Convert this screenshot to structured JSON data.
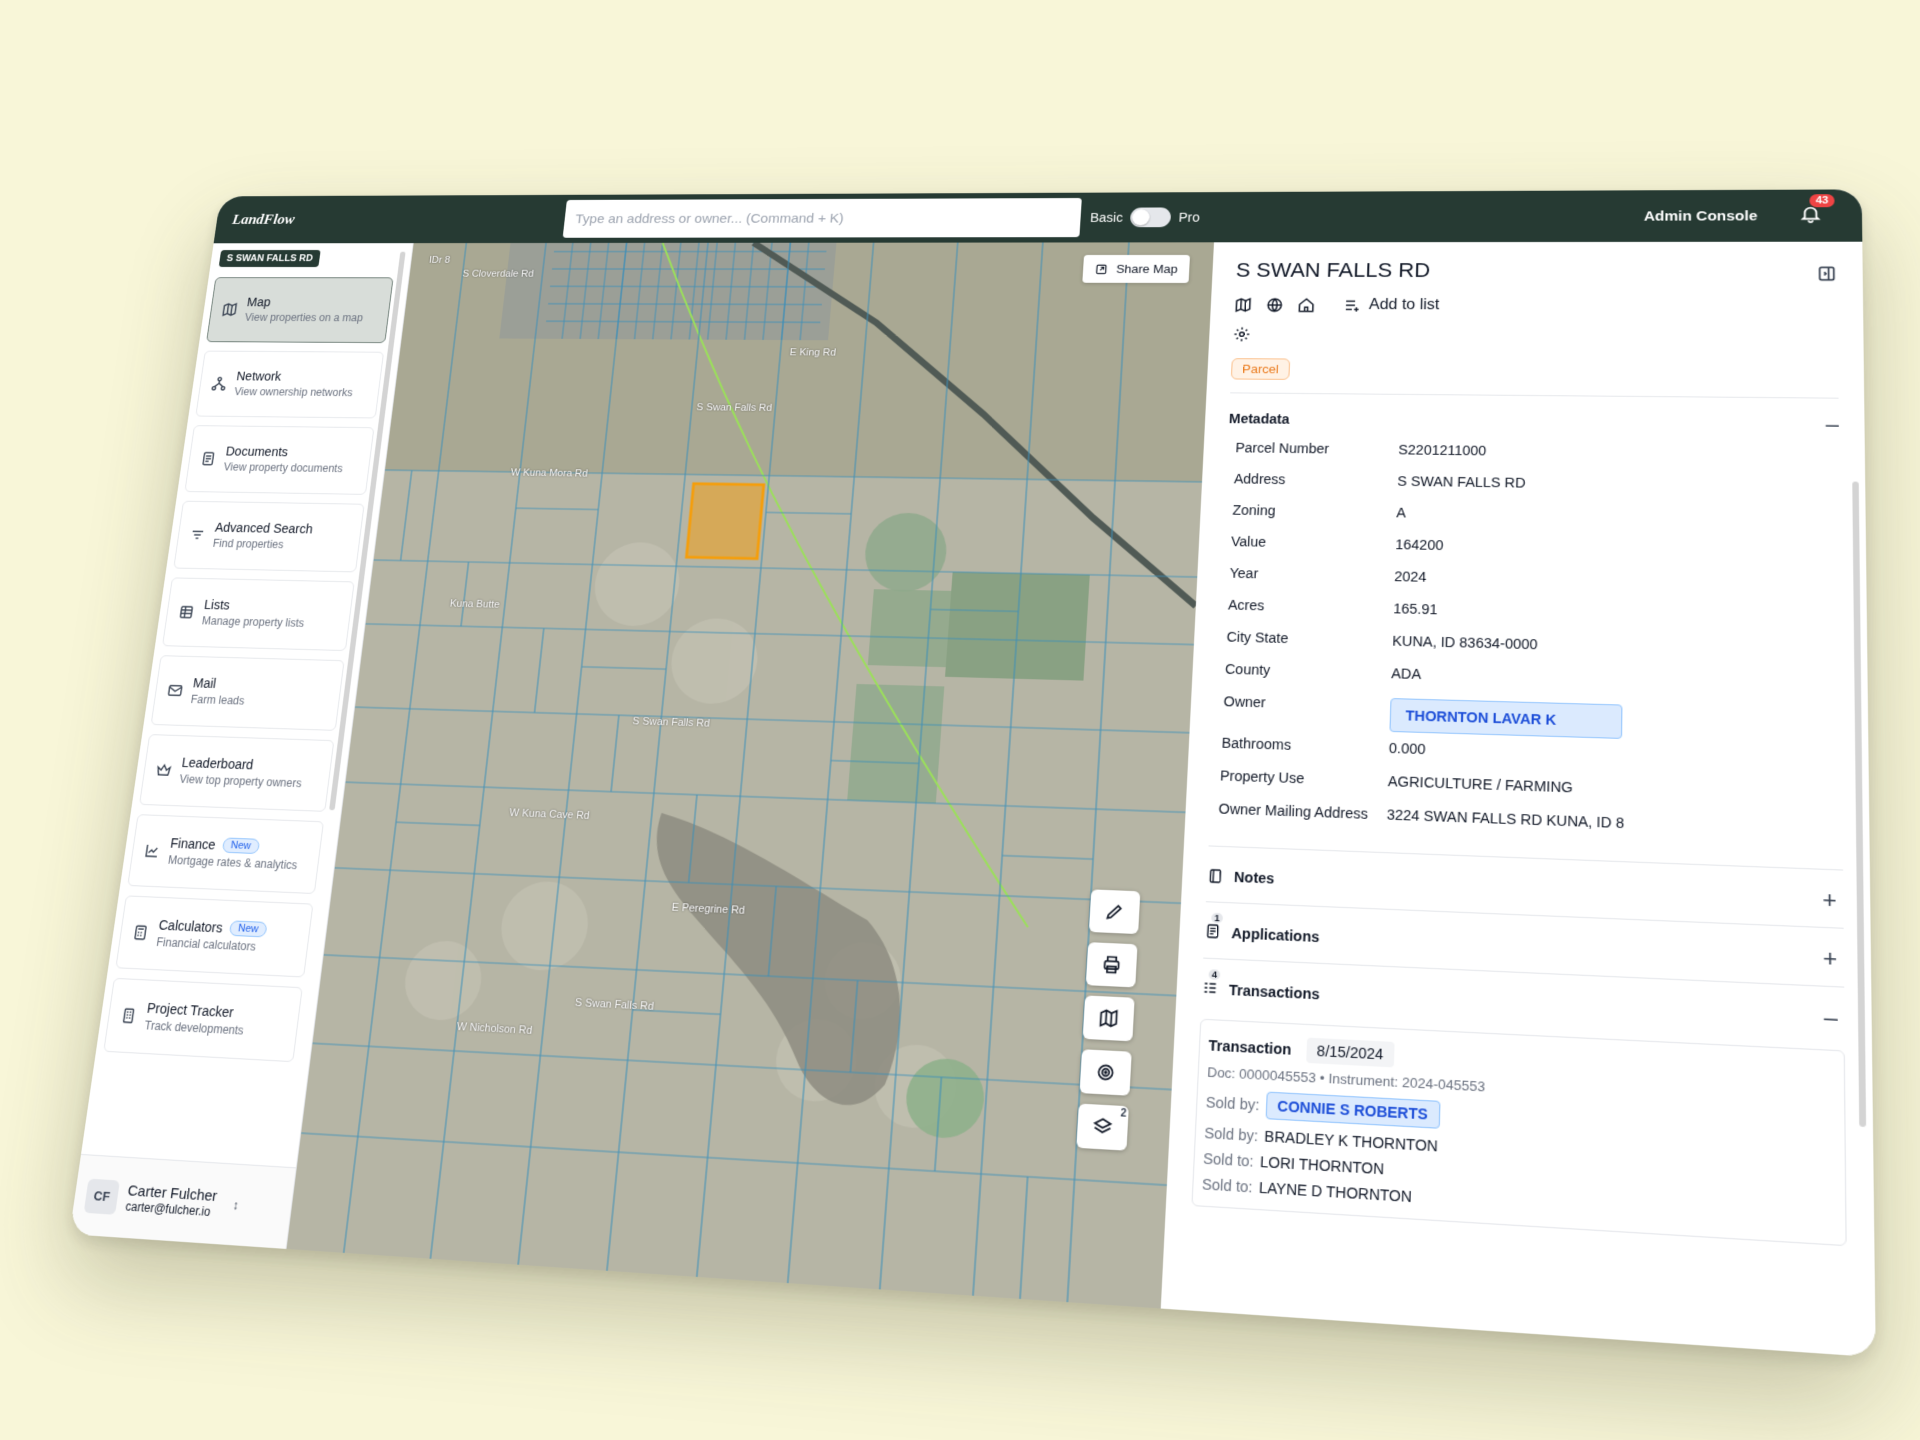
{
  "app": {
    "logo": "LandFlow",
    "search_placeholder": "Type an address or owner... (Command + K)",
    "mode_basic": "Basic",
    "mode_pro": "Pro",
    "admin_label": "Admin Console",
    "notification_count": "43"
  },
  "sidebar": {
    "location_chip": "S SWAN FALLS RD",
    "items": [
      {
        "title": "Map",
        "subtitle": "View properties on a map",
        "icon": "map-icon",
        "active": true
      },
      {
        "title": "Network",
        "subtitle": "View ownership networks",
        "icon": "network-icon"
      },
      {
        "title": "Documents",
        "subtitle": "View property documents",
        "icon": "document-icon"
      },
      {
        "title": "Advanced Search",
        "subtitle": "Find properties",
        "icon": "filter-icon"
      },
      {
        "title": "Lists",
        "subtitle": "Manage property lists",
        "icon": "list-icon"
      },
      {
        "title": "Mail",
        "subtitle": "Farm leads",
        "icon": "mail-icon"
      },
      {
        "title": "Leaderboard",
        "subtitle": "View top property owners",
        "icon": "crown-icon"
      },
      {
        "title": "Finance",
        "subtitle": "Mortgage rates & analytics",
        "icon": "chart-icon",
        "badge": "New"
      },
      {
        "title": "Calculators",
        "subtitle": "Financial calculators",
        "icon": "calculator-icon",
        "badge": "New"
      },
      {
        "title": "Project Tracker",
        "subtitle": "Track developments",
        "icon": "building-icon"
      }
    ],
    "user": {
      "initials": "CF",
      "name": "Carter Fulcher",
      "email": "carter@fulcher.io"
    }
  },
  "map": {
    "share_label": "Share Map",
    "layers_count": "2",
    "road_labels": [
      "S Cloverdale Rd",
      "W Kuna Mora Rd",
      "S Swan Falls Rd",
      "E King Rd",
      "Kuna Butte",
      "W Kuna Cave Rd",
      "E Peregrine Rd",
      "W Nicholson Rd",
      "S Swan Falls Rd",
      "S Swan Falls Rd",
      "IDr 8"
    ],
    "parcel_highlight_color": "#f59e0b"
  },
  "panel": {
    "title": "S SWAN FALLS RD",
    "add_to_list": "Add to list",
    "type_badge": "Parcel",
    "metadata_label": "Metadata",
    "metadata": [
      {
        "key": "Parcel Number",
        "value": "S2201211000"
      },
      {
        "key": "Address",
        "value": "S SWAN FALLS RD"
      },
      {
        "key": "Zoning",
        "value": "A"
      },
      {
        "key": "Value",
        "value": "164200"
      },
      {
        "key": "Year",
        "value": "2024"
      },
      {
        "key": "Acres",
        "value": "165.91"
      },
      {
        "key": "City State",
        "value": "KUNA, ID 83634-0000"
      },
      {
        "key": "County",
        "value": "ADA"
      },
      {
        "key": "Owner",
        "value": "THORNTON LAVAR K"
      },
      {
        "key": "Bathrooms",
        "value": "0.000"
      },
      {
        "key": "Property Use",
        "value": "AGRICULTURE / FARMING"
      },
      {
        "key": "Owner Mailing Address",
        "value": "3224 SWAN FALLS RD KUNA, ID 8"
      }
    ],
    "notes_label": "Notes",
    "applications_label": "Applications",
    "applications_count": "1",
    "transactions_label": "Transactions",
    "transactions_count": "4",
    "transaction": {
      "label": "Transaction",
      "date": "8/15/2024",
      "doc": "Doc: 0000045553 • Instrument: 2024-045553",
      "sold_by_label": "Sold by:",
      "sold_to_label": "Sold to:",
      "seller_1": "CONNIE S ROBERTS",
      "seller_2": "BRADLEY K THORNTON",
      "buyer_1": "LORI THORNTON",
      "buyer_2": "LAYNE D THORNTON"
    }
  }
}
